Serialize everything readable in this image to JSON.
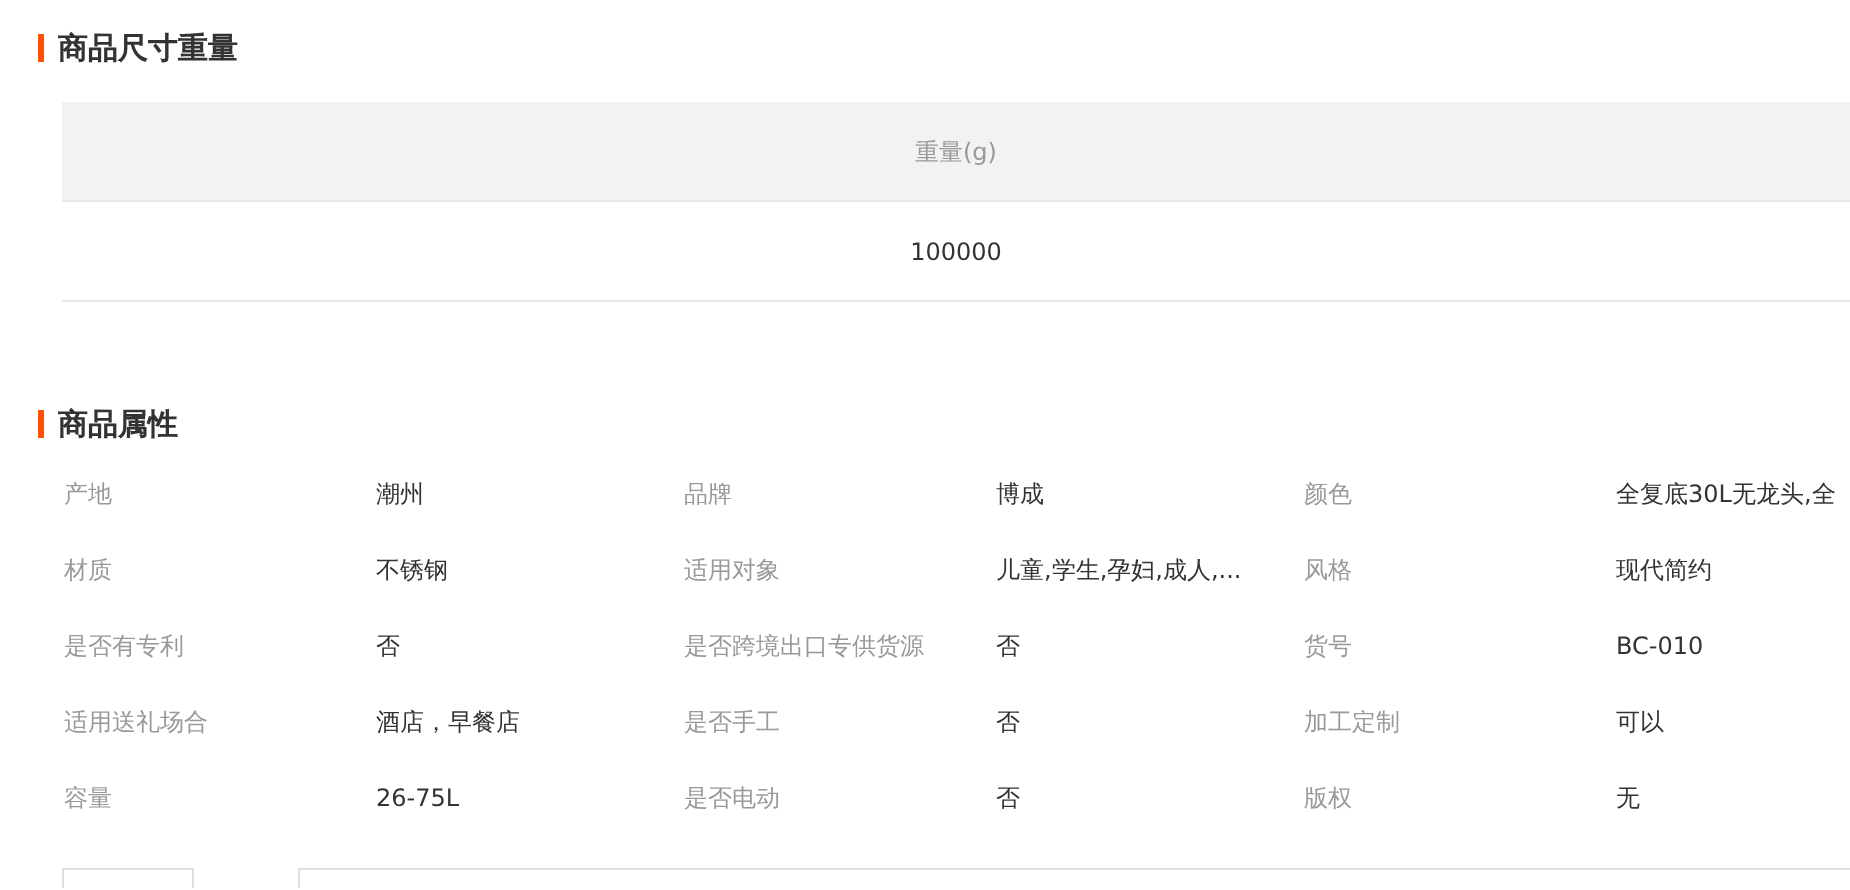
{
  "size_section": {
    "title": "商品尺寸重量",
    "columns": [
      "重量(g)"
    ],
    "rows": [
      [
        "100000"
      ]
    ]
  },
  "attributes_section": {
    "title": "商品属性",
    "rows": [
      [
        {
          "label": "产地",
          "value": "潮州"
        },
        {
          "label": "品牌",
          "value": "博成"
        },
        {
          "label": "颜色",
          "value": "全复底30L无龙头,全"
        }
      ],
      [
        {
          "label": "材质",
          "value": "不锈钢"
        },
        {
          "label": "适用对象",
          "value": "儿童,学生,孕妇,成人,..."
        },
        {
          "label": "风格",
          "value": "现代简约"
        }
      ],
      [
        {
          "label": "是否有专利",
          "value": "否"
        },
        {
          "label": "是否跨境出口专供货源",
          "value": "否"
        },
        {
          "label": "货号",
          "value": "BC-010"
        }
      ],
      [
        {
          "label": "适用送礼场合",
          "value": "酒店，早餐店"
        },
        {
          "label": "是否手工",
          "value": "否"
        },
        {
          "label": "加工定制",
          "value": "可以"
        }
      ],
      [
        {
          "label": "容量",
          "value": "26-75L"
        },
        {
          "label": "是否电动",
          "value": "否"
        },
        {
          "label": "版权",
          "value": "无"
        }
      ]
    ]
  }
}
